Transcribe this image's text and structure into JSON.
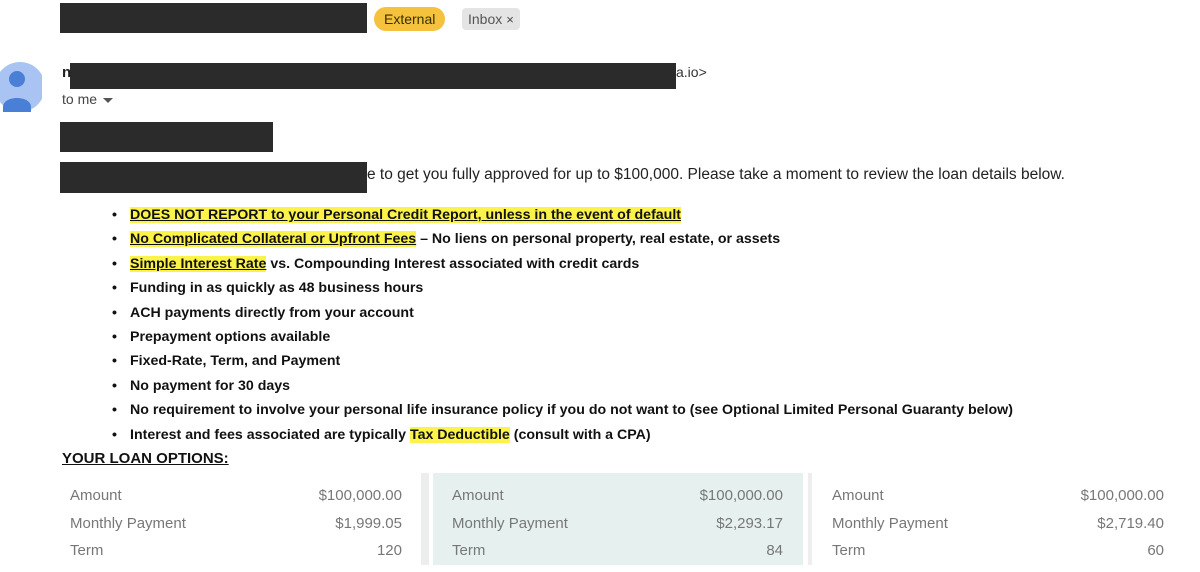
{
  "header": {
    "chip_external": "External",
    "chip_inbox": "Inbox",
    "chip_inbox_close": "×"
  },
  "sender": {
    "initial": "n",
    "email_tail": "a.io>",
    "to_me": "to me"
  },
  "body": {
    "intro": "e to get you fully approved for up to $100,000. Please take a moment to review the loan details below.",
    "features": [
      {
        "pre": "",
        "hl": "DOES NOT REPORT to your Personal Credit Report, unless in the event of default",
        "post": ""
      },
      {
        "pre": "",
        "hl": "No Complicated Collateral or Upfront Fees",
        "post": " – No liens on personal property, real estate, or assets"
      },
      {
        "pre": "",
        "hl": "Simple Interest Rate",
        "post": " vs. Compounding Interest associated with credit cards"
      },
      {
        "pre": "Funding in as quickly as 48 business hours",
        "hl": "",
        "post": ""
      },
      {
        "pre": "ACH payments directly from your account",
        "hl": "",
        "post": ""
      },
      {
        "pre": "Prepayment options available",
        "hl": "",
        "post": ""
      },
      {
        "pre": "Fixed-Rate, Term, and Payment",
        "hl": "",
        "post": ""
      },
      {
        "pre": "No payment for 30 days",
        "hl": "",
        "post": ""
      },
      {
        "pre": "No requirement to involve your personal life insurance policy if you do not want to (see Optional Limited Personal Guaranty below)",
        "hl": "",
        "post": ""
      },
      {
        "pre": "Interest and fees associated are typically ",
        "hl": "Tax Deductible",
        "post": " (consult with a CPA)"
      }
    ],
    "options_title": "YOUR LOAN OPTIONS:"
  },
  "loan_options": [
    {
      "amount_label": "Amount",
      "amount": "$100,000.00",
      "payment_label": "Monthly Payment",
      "payment": "$1,999.05",
      "term_label": "Term",
      "term": "120"
    },
    {
      "amount_label": "Amount",
      "amount": "$100,000.00",
      "payment_label": "Monthly Payment",
      "payment": "$2,293.17",
      "term_label": "Term",
      "term": "84"
    },
    {
      "amount_label": "Amount",
      "amount": "$100,000.00",
      "payment_label": "Monthly Payment",
      "payment": "$2,719.40",
      "term_label": "Term",
      "term": "60"
    }
  ],
  "colors": {
    "highlight": "#fbf24a",
    "external_chip": "#f4c23c",
    "selected_option_bg": "#e6f1ef",
    "avatar": "#4a7fd6"
  },
  "icons": [
    "avatar-icon",
    "caret-down-icon",
    "close-icon"
  ]
}
